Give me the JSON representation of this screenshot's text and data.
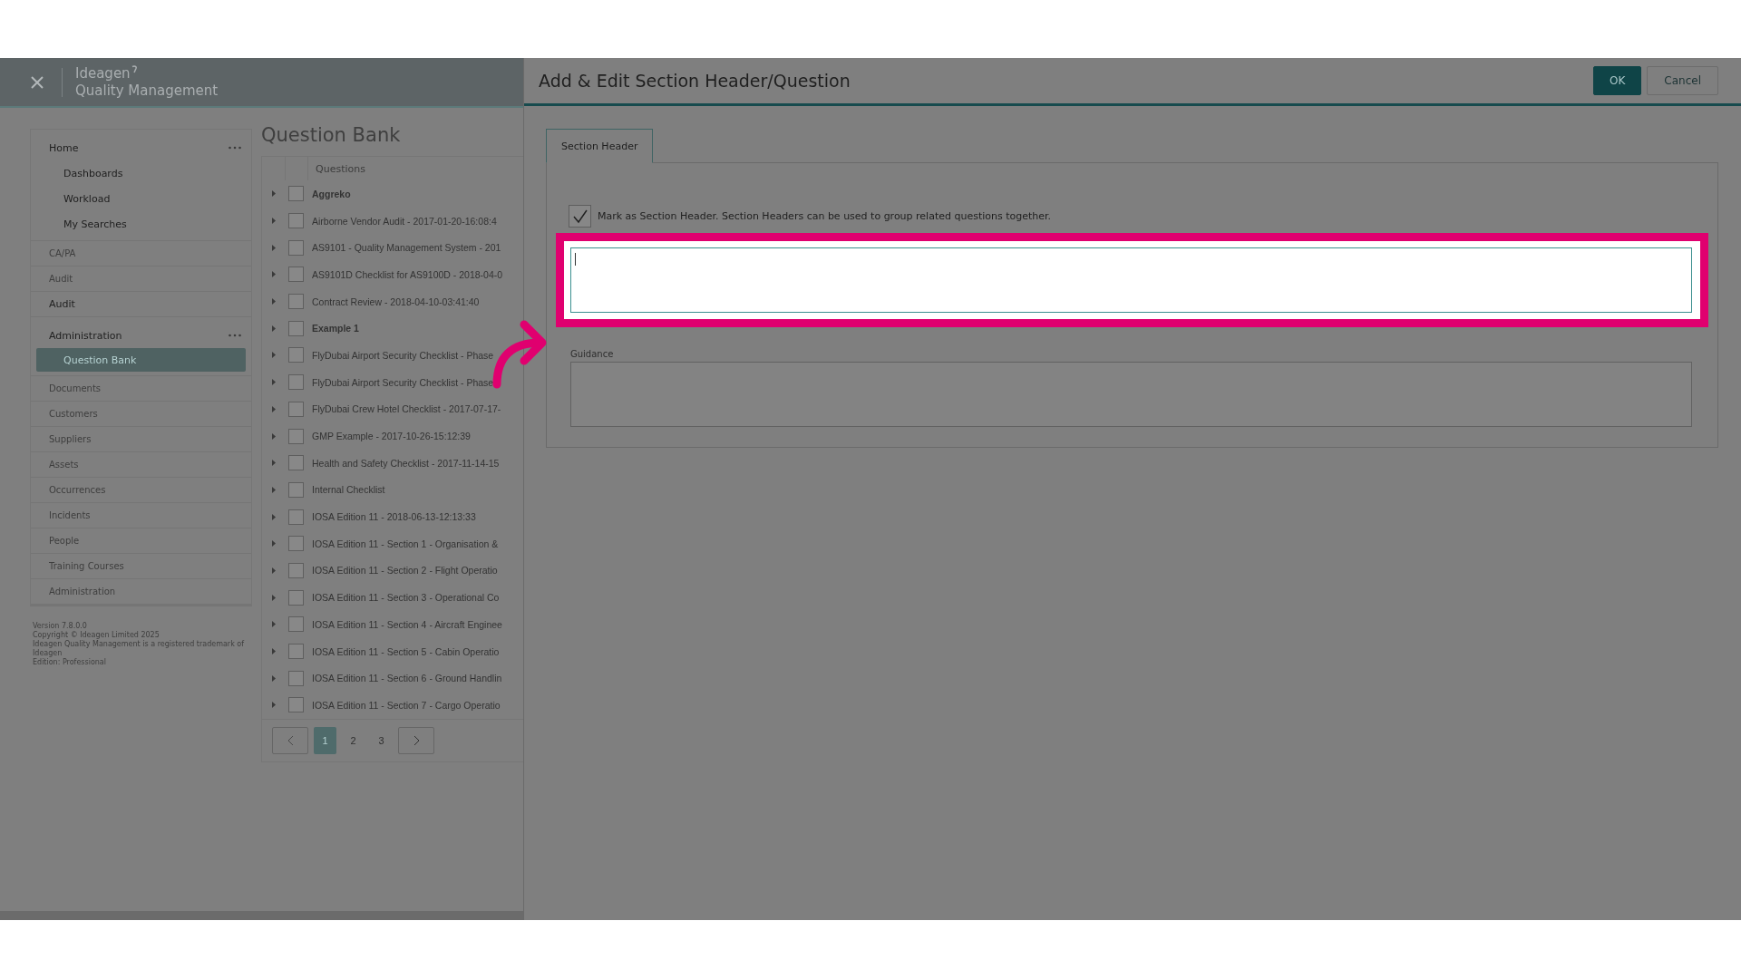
{
  "app_header": {
    "brand": "Ideagen",
    "product": "Quality Management"
  },
  "sidebar": {
    "items": [
      {
        "label": "Home",
        "disabled": false,
        "has_menu": true,
        "children": [
          {
            "label": "Dashboards",
            "selected": false
          },
          {
            "label": "Workload",
            "selected": false
          },
          {
            "label": "My Searches",
            "selected": false
          }
        ]
      },
      {
        "label": "CA/PA",
        "disabled": true,
        "has_menu": false
      },
      {
        "label": "Audit",
        "disabled": true,
        "has_menu": false
      },
      {
        "label": "Audit",
        "disabled": false,
        "has_menu": false
      },
      {
        "label": "Administration",
        "disabled": false,
        "has_menu": true,
        "children": [
          {
            "label": "Question Bank",
            "selected": true
          }
        ]
      },
      {
        "label": "Documents",
        "disabled": true,
        "has_menu": false
      },
      {
        "label": "Customers",
        "disabled": true,
        "has_menu": false
      },
      {
        "label": "Suppliers",
        "disabled": true,
        "has_menu": false
      },
      {
        "label": "Assets",
        "disabled": true,
        "has_menu": false
      },
      {
        "label": "Occurrences",
        "disabled": true,
        "has_menu": false
      },
      {
        "label": "Incidents",
        "disabled": true,
        "has_menu": false
      },
      {
        "label": "People",
        "disabled": true,
        "has_menu": false
      },
      {
        "label": "Training Courses",
        "disabled": true,
        "has_menu": false
      },
      {
        "label": "Administration",
        "disabled": true,
        "has_menu": false
      }
    ],
    "footer": [
      "Version 7.8.0.0",
      "Copyright © Ideagen Limited 2025",
      "Ideagen Quality Management is a registered trademark of Ideagen",
      "Edition: Professional"
    ]
  },
  "page": {
    "title": "Question Bank",
    "table": {
      "columns": [
        "Questions"
      ],
      "rows": [
        {
          "text": "Aggreko",
          "bold": true,
          "checked": false
        },
        {
          "text": "Airborne Vendor Audit - 2017-01-20-16:08:4",
          "bold": false,
          "checked": false
        },
        {
          "text": "AS9101 - Quality Management System - 201",
          "bold": false,
          "checked": false
        },
        {
          "text": "AS9101D Checklist for AS9100D - 2018-04-0",
          "bold": false,
          "checked": false
        },
        {
          "text": "Contract Review - 2018-04-10-03:41:40",
          "bold": false,
          "checked": false
        },
        {
          "text": "Example 1",
          "bold": true,
          "checked": false
        },
        {
          "text": "FlyDubai Airport Security Checklist - Phase",
          "bold": false,
          "checked": false
        },
        {
          "text": "FlyDubai Airport Security Checklist - Phase",
          "bold": false,
          "checked": false
        },
        {
          "text": "FlyDubai Crew Hotel Checklist - 2017-07-17-",
          "bold": false,
          "checked": false
        },
        {
          "text": "GMP Example - 2017-10-26-15:12:39",
          "bold": false,
          "checked": false
        },
        {
          "text": "Health and Safety Checklist - 2017-11-14-15",
          "bold": false,
          "checked": false
        },
        {
          "text": "Internal Checklist",
          "bold": false,
          "checked": false
        },
        {
          "text": "IOSA Edition 11 - 2018-06-13-12:13:33",
          "bold": false,
          "checked": false
        },
        {
          "text": "IOSA Edition 11 - Section 1 - Organisation &",
          "bold": false,
          "checked": false
        },
        {
          "text": "IOSA Edition 11 - Section 2 - Flight Operatio",
          "bold": false,
          "checked": false
        },
        {
          "text": "IOSA Edition 11 - Section 3 - Operational Co",
          "bold": false,
          "checked": false
        },
        {
          "text": "IOSA Edition 11 - Section 4 - Aircraft Enginee",
          "bold": false,
          "checked": false
        },
        {
          "text": "IOSA Edition 11 - Section 5 - Cabin Operatio",
          "bold": false,
          "checked": false
        },
        {
          "text": "IOSA Edition 11 - Section 6 - Ground Handlin",
          "bold": false,
          "checked": false
        },
        {
          "text": "IOSA Edition 11 - Section 7 - Cargo Operatio",
          "bold": false,
          "checked": false
        }
      ]
    },
    "pagination": {
      "pages": [
        {
          "label": "1",
          "selected": true
        },
        {
          "label": "2",
          "selected": false
        },
        {
          "label": "3",
          "selected": false
        }
      ]
    }
  },
  "dialog": {
    "title": "Add & Edit Section Header/Question",
    "buttons": [
      {
        "label": "OK",
        "kind": "primary"
      },
      {
        "label": "Cancel",
        "kind": "secondary"
      }
    ],
    "tabs": [
      {
        "label": "Section Header",
        "selected": true
      }
    ],
    "section_checkbox": {
      "label": "Mark as Section Header. Section Headers can be used to group related questions together.",
      "checked": true
    },
    "section_header_field": {
      "focused": true,
      "highlighted": true
    },
    "guidance": {
      "label": "Guidance"
    }
  }
}
